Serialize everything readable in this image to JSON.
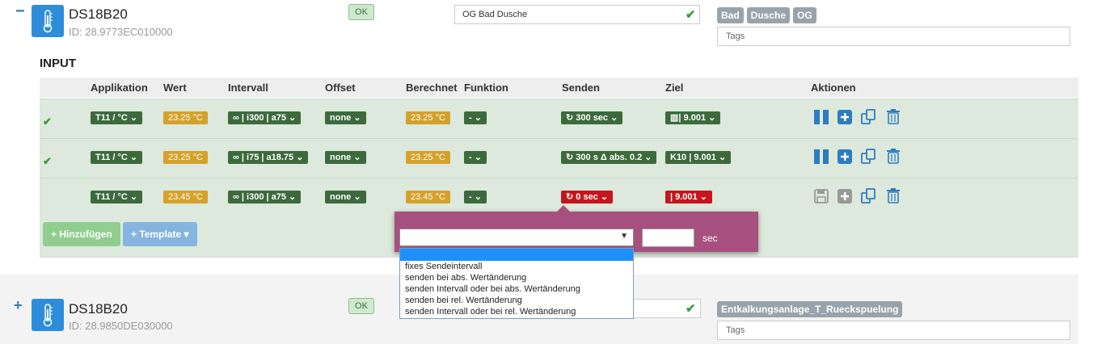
{
  "device1": {
    "toggle": "−",
    "name": "DS18B20",
    "id": "ID: 28.9773EC010000",
    "status": "OK",
    "location": "OG Bad Dusche",
    "tags": [
      "Bad",
      "Dusche",
      "OG"
    ],
    "tags_placeholder": "Tags"
  },
  "input": {
    "title": "INPUT",
    "headers": [
      "Applikation",
      "Wert",
      "Intervall",
      "Offset",
      "Berechnet",
      "Funktion",
      "Senden",
      "Ziel",
      "Aktionen"
    ],
    "rows": [
      {
        "active": "✔",
        "app": "T11 / °C ⌄",
        "value": "23.25 °C",
        "interval": "∞ | i300 | a75 ⌄",
        "offset": "none ⌄",
        "computed": "23.25 °C",
        "func": "- ⌄",
        "send": "300 sec ⌄",
        "target": "| 9.001 ⌄",
        "target_prefix": "▥"
      },
      {
        "active": "✔",
        "app": "T11 / °C ⌄",
        "value": "23.25 °C",
        "interval": "∞ | i75 | a18.75 ⌄",
        "offset": "none ⌄",
        "computed": "23.25 °C",
        "func": "- ⌄",
        "send": "300 s Δ abs. 0.2 ⌄",
        "target": "K10 | 9.001 ⌄",
        "target_prefix": ""
      },
      {
        "active": "",
        "app": "T11 / °C ⌄",
        "value": "23.45 °C",
        "interval": "∞ | i300 | a75 ⌄",
        "offset": "none ⌄",
        "computed": "23.45 °C",
        "func": "- ⌄",
        "send": "0 sec ⌄",
        "target": "| 9.001 ⌄",
        "target_prefix": ""
      }
    ],
    "add_button": "Hinzufügen",
    "template_button": "Template"
  },
  "send_popover": {
    "select_value": "",
    "unit": "sec",
    "interval_value": "",
    "options": [
      "",
      "fixes Sendeintervall",
      "senden bei abs. Wertänderung",
      "senden Intervall oder bei abs. Wertänderung",
      "senden bei rel. Wertänderung",
      "senden Intervall oder bei rel. Wertänderung"
    ]
  },
  "device2": {
    "toggle": "+",
    "name": "DS18B20",
    "id": "ID: 28.9850DE030000",
    "status": "OK",
    "tags": [
      "Entkalkungsanlage_T_Rueckspuelung"
    ],
    "tags_placeholder": "Tags"
  },
  "colors": {
    "accent": "#2e7cc0",
    "row_bg": "#dce9dc",
    "pill_green": "#3d6a3d",
    "pill_orange": "#d4a12a",
    "pill_red": "#c4161c",
    "popover": "#a7507f"
  }
}
